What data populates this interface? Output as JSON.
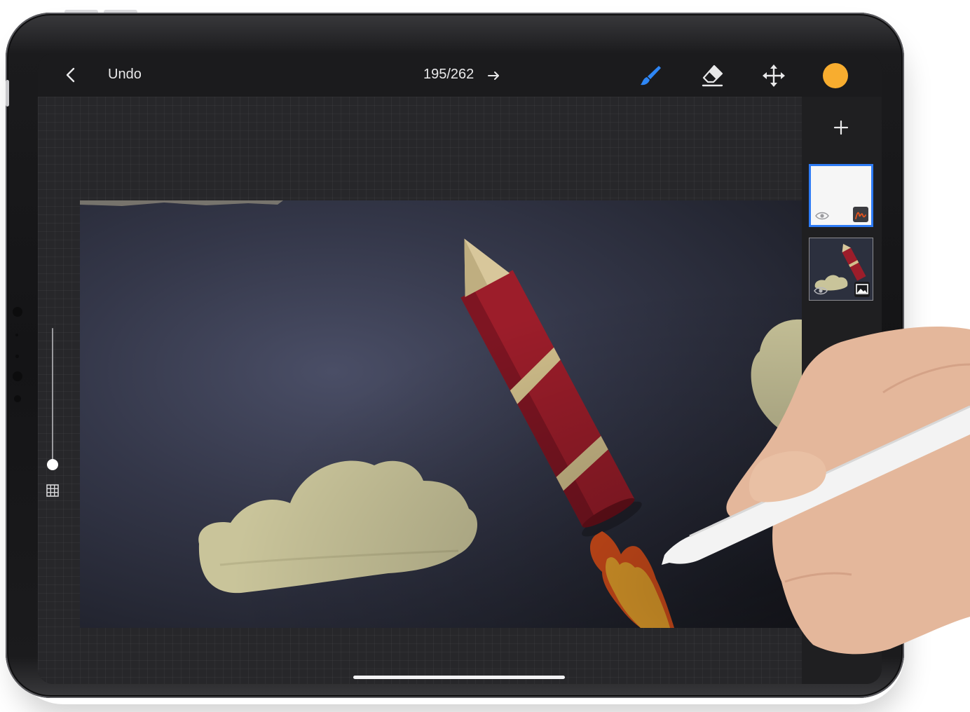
{
  "topbar": {
    "back_icon": "chevron-left-icon",
    "undo_label": "Undo",
    "frame_counter": "195/262",
    "next_frame_icon": "arrow-right-icon",
    "tools": [
      {
        "name": "brush",
        "icon": "brush-icon",
        "active": true,
        "color": "#2e86f5"
      },
      {
        "name": "eraser",
        "icon": "eraser-icon",
        "active": false
      },
      {
        "name": "move",
        "icon": "move-icon",
        "active": false
      }
    ],
    "current_color": "#f8ad2f"
  },
  "layers": {
    "add_icon": "plus-icon",
    "items": [
      {
        "name": "drawing-layer",
        "selected": true,
        "visibility_icon": "eye-icon",
        "type_icon": "drawing-icon"
      },
      {
        "name": "photo-layer",
        "selected": false,
        "visibility_icon": "eye-icon",
        "type_icon": "image-icon"
      }
    ]
  },
  "left_controls": {
    "brush_size_level": 0.1,
    "grid_icon": "grid-icon"
  },
  "canvas": {
    "content": "photo-with-drawn-flame"
  },
  "colors": {
    "accent_blue": "#2e7cf6",
    "flame_orange": "#f8ad2f",
    "flame_red": "#e6541d"
  }
}
